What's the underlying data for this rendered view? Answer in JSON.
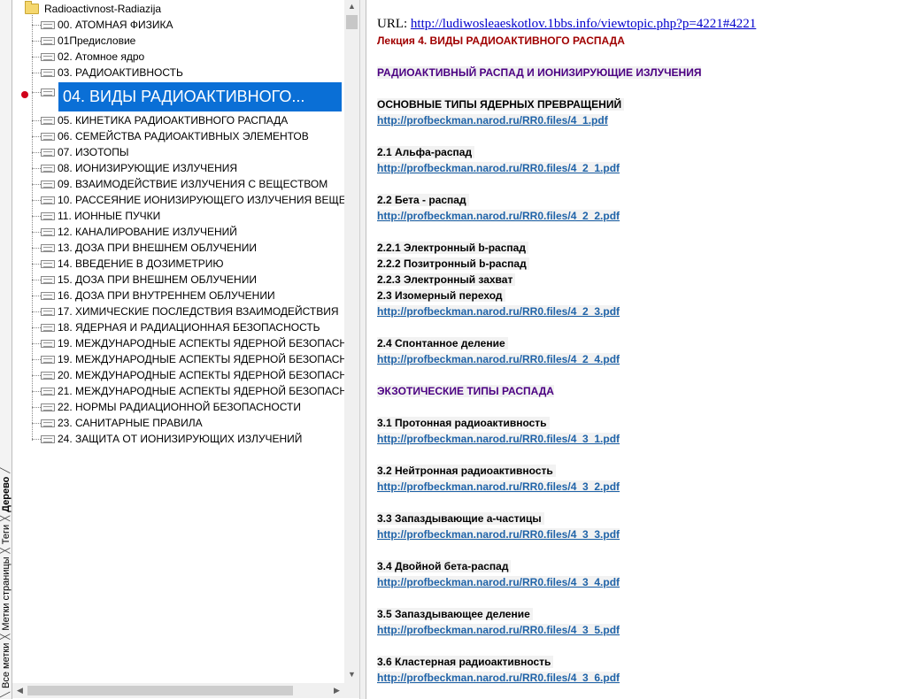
{
  "side_tabs": [
    "Все метки",
    "Метки страницы",
    "Теги",
    "Дерево"
  ],
  "side_tabs_active": "Дерево",
  "tree": {
    "root_label": "Radioactivnost-Radiazija",
    "items": [
      "00. АТОМНАЯ ФИЗИКА",
      "01Предисловие",
      "02.  Атомное ядро",
      "03. РАДИОАКТИВНОСТЬ",
      "04. ВИДЫ РАДИОАКТИВНОГО...",
      "05. КИНЕТИКА РАДИОАКТИВНОГО РАСПАДА",
      "06. СЕМЕЙСТВА РАДИОАКТИВНЫХ ЭЛЕМЕНТОВ",
      "07. ИЗОТОПЫ",
      "08. ИОНИЗИРУЮЩИЕ ИЗЛУЧЕНИЯ",
      "09. ВЗАИМОДЕЙСТВИЕ ИЗЛУЧЕНИЯ С ВЕЩЕСТВОМ",
      "10. РАССЕЯНИЕ ИОНИЗИРУЮЩЕГО ИЗЛУЧЕНИЯ ВЕЩЕ",
      "11. ИОННЫЕ ПУЧКИ",
      "12. КАНАЛИРОВАНИЕ ИЗЛУЧЕНИЙ",
      "13. ДОЗА ПРИ ВНЕШНЕМ ОБЛУЧЕНИИ",
      "14. ВВЕДЕНИЕ В ДОЗИМЕТРИЮ",
      "15. ДОЗА ПРИ ВНЕШНЕМ ОБЛУЧЕНИИ",
      "16. ДОЗА ПРИ ВНУТРЕННЕМ ОБЛУЧЕНИИ",
      "17. ХИМИЧЕСКИЕ ПОСЛЕДСТВИЯ ВЗАИМОДЕЙСТВИЯ",
      "18. ЯДЕРНАЯ И РАДИАЦИОННАЯ БЕЗОПАСНОСТЬ",
      "19. МЕЖДУНАРОДНЫЕ АСПЕКТЫ ЯДЕРНОЙ БЕЗОПАСН",
      "19. МЕЖДУНАРОДНЫЕ АСПЕКТЫ ЯДЕРНОЙ БЕЗОПАСН",
      "20. МЕЖДУНАРОДНЫЕ АСПЕКТЫ ЯДЕРНОЙ БЕЗОПАСН",
      "21. МЕЖДУНАРОДНЫЕ АСПЕКТЫ ЯДЕРНОЙ БЕЗОПАСН",
      "22. НОРМЫ РАДИАЦИОННОЙ БЕЗОПАСНОСТИ",
      "23. САНИТАРНЫЕ ПРАВИЛА",
      "24. ЗАЩИТА ОТ ИОНИЗИРУЮЩИХ ИЗЛУЧЕНИЙ"
    ],
    "selected_index": 4
  },
  "content": {
    "url_prefix": "URL:",
    "url": "http://ludiwosleaeskotlov.1bbs.info/viewtopic.php?p=4221#4221",
    "lecture_title": "Лекция 4. ВИДЫ РАДИОАКТИВНОГО РАСПАДА",
    "section1_title": "РАДИОАКТИВНЫЙ РАСПАД И ИОНИЗИРУЮЩИЕ ИЗЛУЧЕНИЯ",
    "main_types": "ОСНОВНЫЕ ТИПЫ ЯДЕРНЫХ ПРЕВРАЩЕНИЙ",
    "link_4_1": "http://profbeckman.narod.ru/RR0.files/4_1.pdf",
    "alpha": "2.1 Альфа-распад",
    "link_4_2_1": "http://profbeckman.narod.ru/RR0.files/4_2_1.pdf",
    "beta": "2.2 Бета - распад",
    "link_4_2_2": "http://profbeckman.narod.ru/RR0.files/4_2_2.pdf",
    "beta_electron": "2.2.1 Электронный b-распад",
    "beta_positron": "2.2.2 Позитронный b-распад",
    "electron_capture": "2.2.3 Электронный захват",
    "isomeric": "2.3 Изомерный переход",
    "link_4_2_3": "http://profbeckman.narod.ru/RR0.files/4_2_3.pdf",
    "fission": "2.4 Спонтанное деление",
    "link_4_2_4": "http://profbeckman.narod.ru/RR0.files/4_2_4.pdf",
    "section2_title": "ЭКЗОТИЧЕСКИЕ ТИПЫ РАСПАДА",
    "proton": "3.1 Протонная радиоактивность",
    "link_4_3_1": "http://profbeckman.narod.ru/RR0.files/4_3_1.pdf",
    "neutron": "3.2 Нейтронная радиоактивность",
    "link_4_3_2": "http://profbeckman.narod.ru/RR0.files/4_3_2.pdf",
    "delayed_alpha": "3.3 Запаздывающие а-частицы",
    "link_4_3_3": "http://profbeckman.narod.ru/RR0.files/4_3_3.pdf",
    "double_beta": "3.4 Двойной бета-распад",
    "link_4_3_4": "http://profbeckman.narod.ru/RR0.files/4_3_4.pdf",
    "delayed_fission": "3.5 Запаздывающее деление",
    "link_4_3_5": "http://profbeckman.narod.ru/RR0.files/4_3_5.pdf",
    "cluster": "3.6 Кластерная радиоактивность",
    "link_4_3_6": "http://profbeckman.narod.ru/RR0.files/4_3_6.pdf"
  }
}
